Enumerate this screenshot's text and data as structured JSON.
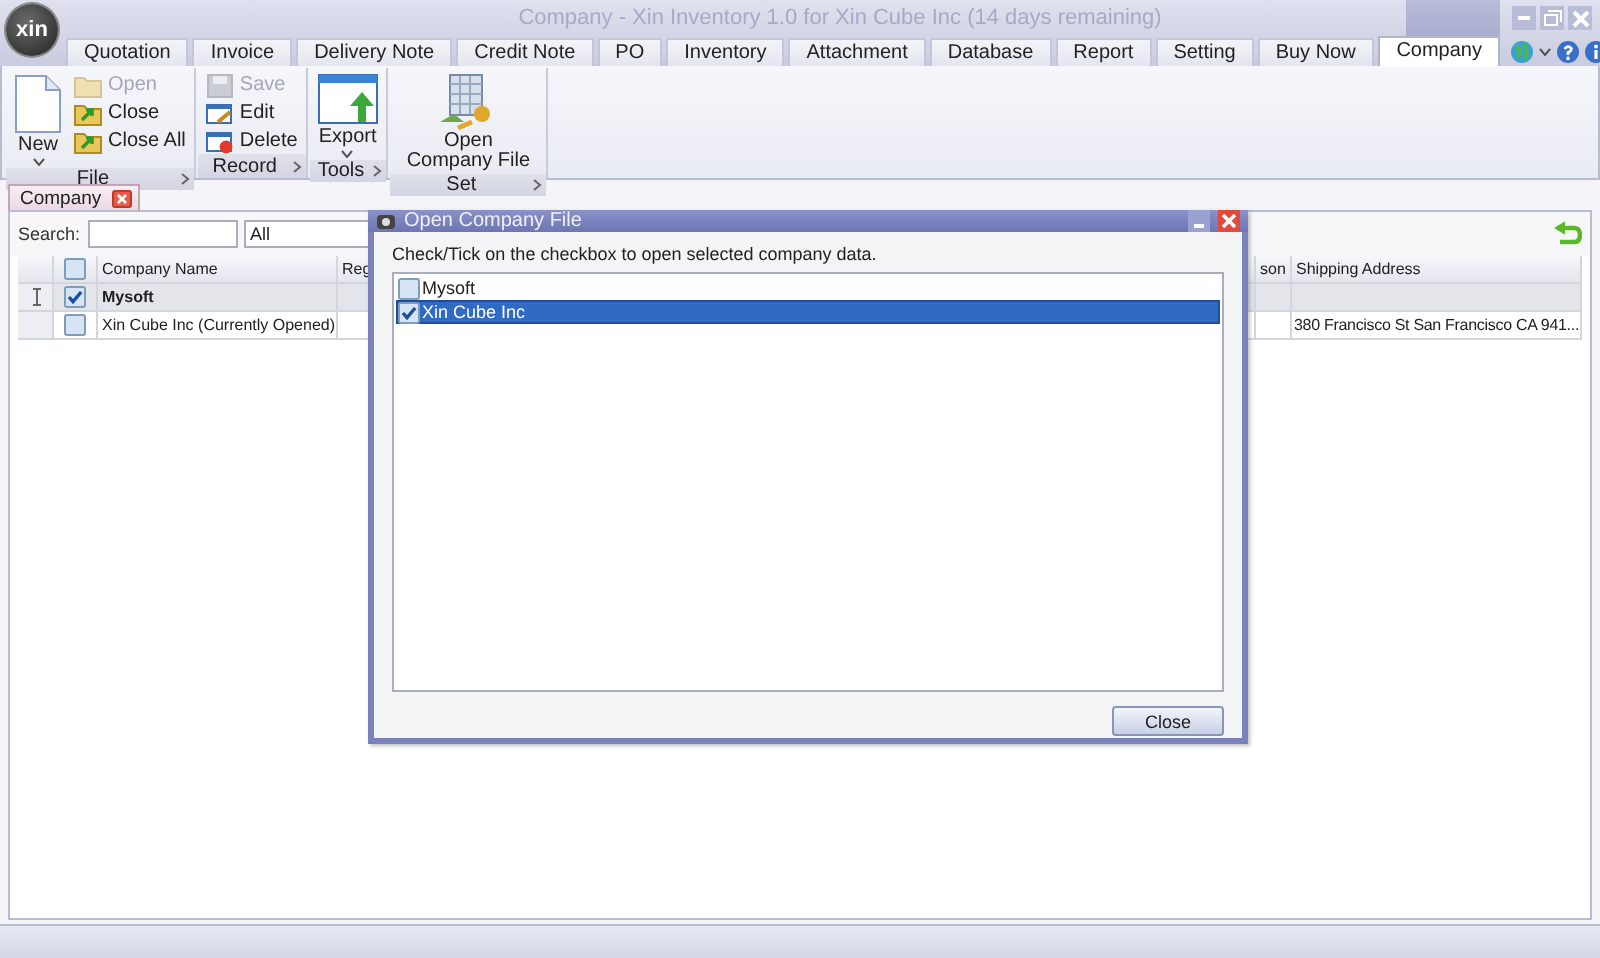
{
  "window": {
    "title": "Company - Xin Inventory 1.0 for Xin Cube Inc (14 days remaining)",
    "logo": "xin"
  },
  "menu_tabs": [
    {
      "label": "Quotation",
      "selected": false
    },
    {
      "label": "Invoice",
      "selected": false
    },
    {
      "label": "Delivery Note",
      "selected": false
    },
    {
      "label": "Credit Note",
      "selected": false
    },
    {
      "label": "PO",
      "selected": false
    },
    {
      "label": "Inventory",
      "selected": false
    },
    {
      "label": "Attachment",
      "selected": false
    },
    {
      "label": "Database",
      "selected": false
    },
    {
      "label": "Report",
      "selected": false
    },
    {
      "label": "Setting",
      "selected": false
    },
    {
      "label": "Buy Now",
      "selected": false
    },
    {
      "label": "Company",
      "selected": true
    }
  ],
  "ribbon": {
    "groups": [
      {
        "label": "File",
        "items": [
          {
            "label": "New",
            "kind": "large",
            "dropdown": true,
            "disabled": false
          },
          {
            "label": "Open",
            "kind": "small",
            "disabled": true
          },
          {
            "label": "Close",
            "kind": "small",
            "disabled": false
          },
          {
            "label": "Close All",
            "kind": "small",
            "disabled": false
          }
        ]
      },
      {
        "label": "Record",
        "items": [
          {
            "label": "Save",
            "kind": "small",
            "disabled": true
          },
          {
            "label": "Edit",
            "kind": "small",
            "disabled": false
          },
          {
            "label": "Delete",
            "kind": "small",
            "disabled": false
          }
        ]
      },
      {
        "label": "Tools",
        "items": [
          {
            "label": "Export",
            "kind": "large",
            "dropdown": true,
            "disabled": false
          }
        ]
      },
      {
        "label": "Set",
        "items": [
          {
            "label": "Open Company File",
            "kind": "large",
            "dropdown": false,
            "disabled": false
          }
        ]
      }
    ]
  },
  "doc_tabs": [
    {
      "label": "Company",
      "selected": true
    }
  ],
  "search": {
    "label": "Search:",
    "filter": "All"
  },
  "grid": {
    "header_checked": false,
    "columns": [
      "Company Name",
      "Reg",
      "son",
      "Shipping Address"
    ],
    "rows": [
      {
        "selected": true,
        "checked": true,
        "name": "Mysoft"
      },
      {
        "selected": false,
        "checked": false,
        "name": "Xin Cube Inc (Currently Opened)",
        "shipping": "380 Francisco St San Francisco CA 941..."
      }
    ]
  },
  "dialog": {
    "title": "Open Company File",
    "instruction": "Check/Tick on the checkbox to open selected company data.",
    "items": [
      {
        "label": "Mysoft",
        "checked": false,
        "selected": false
      },
      {
        "label": "Xin Cube Inc",
        "checked": true,
        "selected": true
      }
    ],
    "button": "Close"
  }
}
